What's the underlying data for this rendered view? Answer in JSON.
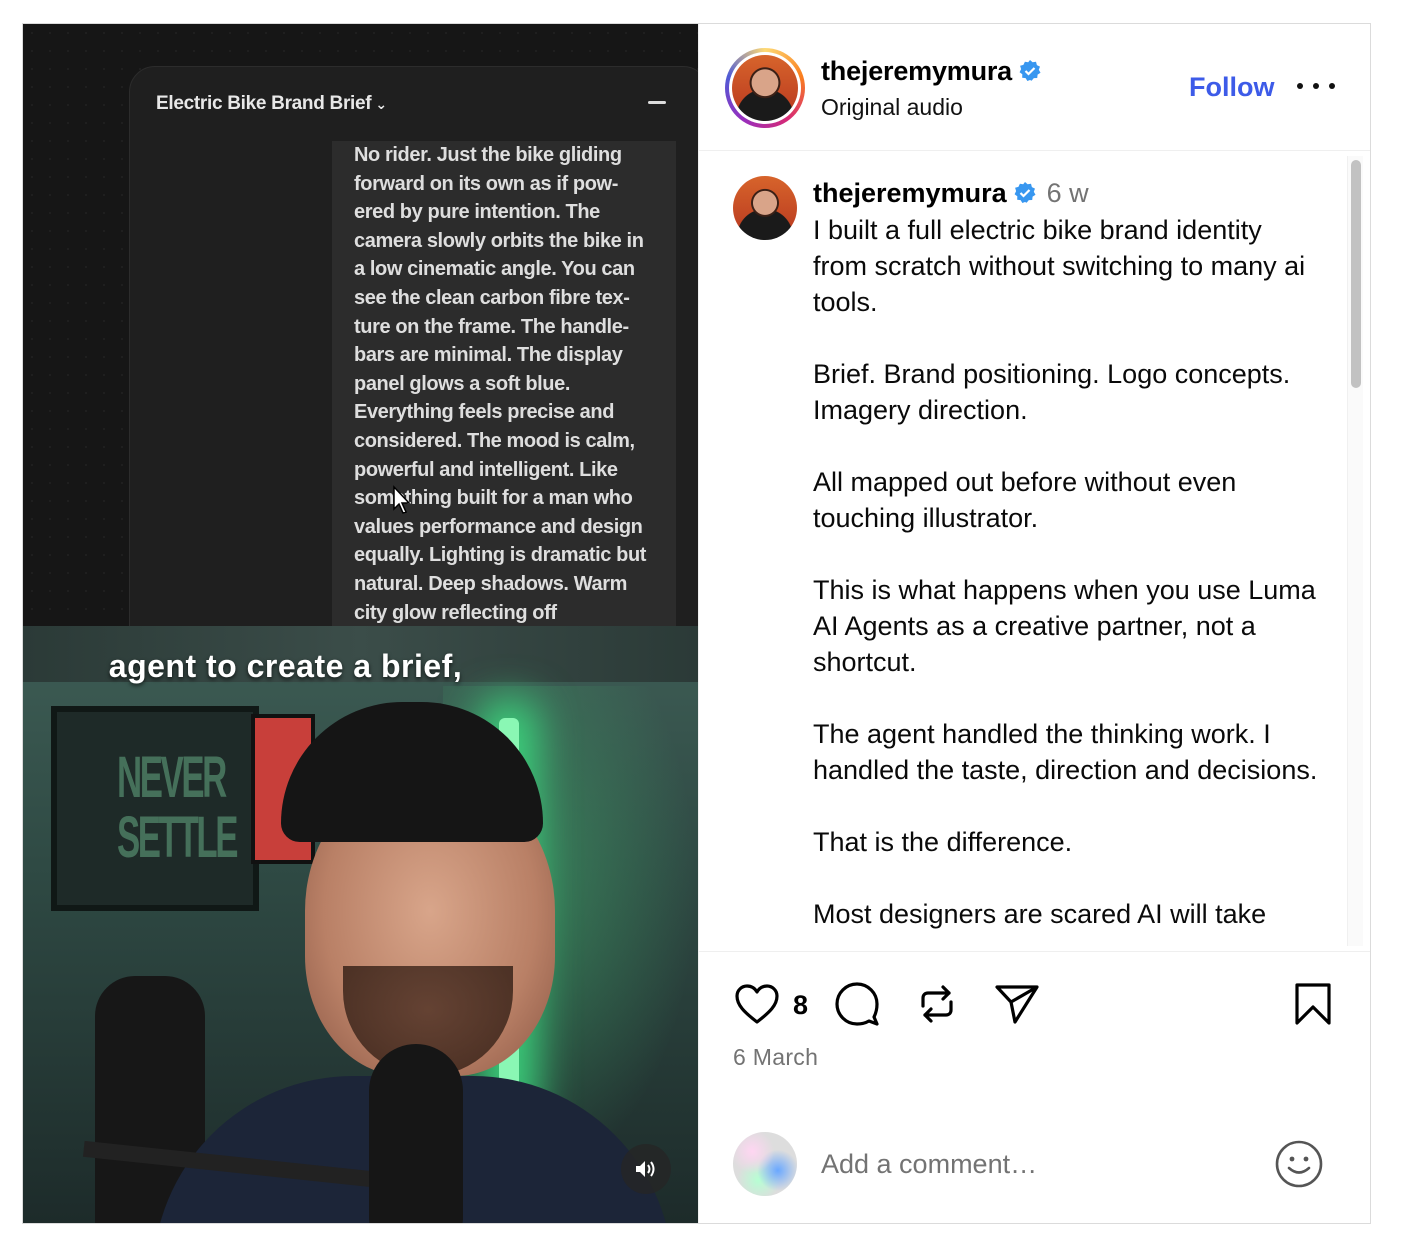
{
  "video": {
    "panel_title": "Electric Bike Brand Brief",
    "brief_text": "No rider. Just the bike gliding forward on its own as if pow-ered by pure intention. The camera slowly orbits the bike in a low cinematic angle. You can see the clean carbon fibre tex-ture on the frame. The handle-bars are minimal. The display panel glows a soft blue. Everything feels precise and considered. The mood is calm, powerful and intelligent. Like something built for a man who values performance and design equally. Lighting is dramatic but natural. Deep shadows. Warm city glow reflecting off",
    "subtitle": "agent to create a brief,",
    "poster_text": "NEVER SETTLE",
    "volume_icon": "speaker-icon"
  },
  "header": {
    "username": "thejeremymura",
    "subtitle": "Original audio",
    "follow_label": "Follow",
    "more_icon": "more-dots-icon"
  },
  "post": {
    "username": "thejeremymura",
    "time": "6 w",
    "caption": "I built a full electric bike brand identity from scratch without switching to many ai tools.\n\nBrief. Brand positioning. Logo concepts. Imagery direction.\n\nAll mapped out before without even touching illustrator.\n\nThis is what happens when you use Luma AI Agents as a creative partner, not a shortcut.\n\nThe agent handled the thinking work. I handled the taste, direction and decisions.\n\nThat is the difference.\n\nMost designers are scared AI will take"
  },
  "actions": {
    "like_count": "8",
    "date": "6 March"
  },
  "comment": {
    "placeholder": "Add a comment…"
  },
  "colors": {
    "accent": "#3d5be8",
    "verified": "#3897f0",
    "muted": "#737373"
  }
}
